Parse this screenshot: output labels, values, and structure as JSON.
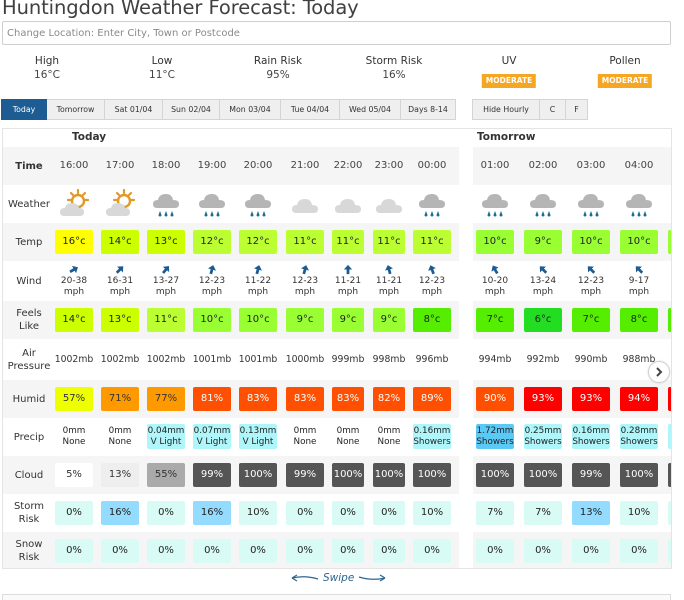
{
  "page": {
    "title": "Huntingdon Weather Forecast: Today",
    "location_placeholder": "Change Location: Enter City, Town or Postcode"
  },
  "summary": {
    "high": {
      "label": "High",
      "value": "16°C"
    },
    "low": {
      "label": "Low",
      "value": "11°C"
    },
    "rain_risk": {
      "label": "Rain Risk",
      "value": "95%"
    },
    "storm_risk": {
      "label": "Storm Risk",
      "value": "16%"
    },
    "uv": {
      "label": "UV",
      "value": "MODERATE"
    },
    "pollen": {
      "label": "Pollen",
      "value": "MODERATE"
    },
    "badge_color": "#f5a623"
  },
  "tabs": [
    {
      "label": "Today",
      "active": true
    },
    {
      "label": "Tomorrow",
      "active": false
    },
    {
      "label": "Sat 01/04",
      "active": false
    },
    {
      "label": "Sun 02/04",
      "active": false
    },
    {
      "label": "Mon 03/04",
      "active": false
    },
    {
      "label": "Tue 04/04",
      "active": false
    },
    {
      "label": "Wed 05/04",
      "active": false
    },
    {
      "label": "Days 8-14",
      "active": false
    }
  ],
  "options": {
    "hide_hourly": "Hide Hourly",
    "celsius": "C",
    "fahrenheit": "F"
  },
  "row_labels": {
    "time": "Time",
    "weather": "Weather",
    "temp": "Temp",
    "wind": "Wind",
    "feels_like": "Feels Like",
    "air_pressure": "Air Pressure",
    "humid": "Humid",
    "precip": "Precip",
    "cloud": "Cloud",
    "storm_risk": "Storm Risk",
    "snow_risk": "Snow Risk"
  },
  "days": [
    {
      "label": "Today"
    },
    {
      "label": "Tomorrow"
    }
  ],
  "hours": [
    {
      "day": 0,
      "time": "16:00",
      "weather": "sun-cloud",
      "temp": "16°c",
      "temp_color": "#ffff00",
      "wind_speed": "20-38",
      "wind_unit": "mph",
      "wind_dir_deg": 60,
      "feels": "14°c",
      "feels_color": "#ccff00",
      "pressure": "1002mb",
      "humid": "57%",
      "humid_color": "#eeff00",
      "humid_text": "#333333",
      "precip_amt": "0mm",
      "precip_type": "None",
      "precip_color": "",
      "cloud": "5%",
      "cloud_color": "#ffffff",
      "cloud_text": "#333333",
      "storm": "0%",
      "storm_color": "#d9fbf6",
      "snow": "0%"
    },
    {
      "day": 0,
      "time": "17:00",
      "weather": "sun-cloud",
      "temp": "14°c",
      "temp_color": "#ccff00",
      "wind_speed": "16-31",
      "wind_unit": "mph",
      "wind_dir_deg": 45,
      "feels": "13°c",
      "feels_color": "#ccff00",
      "pressure": "1002mb",
      "humid": "71%",
      "humid_color": "#ff9900",
      "humid_text": "#333333",
      "precip_amt": "0mm",
      "precip_type": "None",
      "precip_color": "",
      "cloud": "13%",
      "cloud_color": "#eeeeee",
      "cloud_text": "#333333",
      "storm": "16%",
      "storm_color": "#94dcff",
      "snow": "0%"
    },
    {
      "day": 0,
      "time": "18:00",
      "weather": "rain",
      "temp": "13°c",
      "temp_color": "#ccff00",
      "wind_speed": "13-27",
      "wind_unit": "mph",
      "wind_dir_deg": 40,
      "feels": "11°c",
      "feels_color": "#bbff33",
      "pressure": "1002mb",
      "humid": "77%",
      "humid_color": "#ff9900",
      "humid_text": "#333333",
      "precip_amt": "0.04mm",
      "precip_type": "V Light",
      "precip_color": "#aef6fa",
      "cloud": "55%",
      "cloud_color": "#aaaaaa",
      "cloud_text": "#333333",
      "storm": "0%",
      "storm_color": "#d9fbf6",
      "snow": "0%"
    },
    {
      "day": 0,
      "time": "19:00",
      "weather": "rain",
      "temp": "12°c",
      "temp_color": "#bbff33",
      "wind_speed": "12-23",
      "wind_unit": "mph",
      "wind_dir_deg": 15,
      "feels": "10°c",
      "feels_color": "#99ff33",
      "pressure": "1001mb",
      "humid": "81%",
      "humid_color": "#ff4f00",
      "humid_text": "#ffffff",
      "precip_amt": "0.07mm",
      "precip_type": "V Light",
      "precip_color": "#aef6fa",
      "cloud": "99%",
      "cloud_color": "#555555",
      "cloud_text": "#ffffff",
      "storm": "16%",
      "storm_color": "#94dcff",
      "snow": "0%"
    },
    {
      "day": 0,
      "time": "20:00",
      "weather": "rain",
      "temp": "12°c",
      "temp_color": "#bbff33",
      "wind_speed": "11-22",
      "wind_unit": "mph",
      "wind_dir_deg": 15,
      "feels": "10°c",
      "feels_color": "#99ff33",
      "pressure": "1001mb",
      "humid": "83%",
      "humid_color": "#ff4f00",
      "humid_text": "#ffffff",
      "precip_amt": "0.13mm",
      "precip_type": "V Light",
      "precip_color": "#aef6fa",
      "cloud": "100%",
      "cloud_color": "#555555",
      "cloud_text": "#ffffff",
      "storm": "10%",
      "storm_color": "#d9fbf6",
      "snow": "0%"
    },
    {
      "day": 0,
      "time": "21:00",
      "weather": "cloud",
      "temp": "11°c",
      "temp_color": "#bbff33",
      "wind_speed": "12-23",
      "wind_unit": "mph",
      "wind_dir_deg": 15,
      "feels": "9°c",
      "feels_color": "#99ff33",
      "pressure": "1000mb",
      "humid": "83%",
      "humid_color": "#ff4f00",
      "humid_text": "#ffffff",
      "precip_amt": "0mm",
      "precip_type": "None",
      "precip_color": "",
      "cloud": "99%",
      "cloud_color": "#555555",
      "cloud_text": "#ffffff",
      "storm": "0%",
      "storm_color": "#d9fbf6",
      "snow": "0%"
    },
    {
      "day": 0,
      "time": "22:00",
      "weather": "cloud",
      "temp": "11°c",
      "temp_color": "#bbff33",
      "wind_speed": "11-21",
      "wind_unit": "mph",
      "wind_dir_deg": 0,
      "feels": "9°c",
      "feels_color": "#99ff33",
      "pressure": "999mb",
      "humid": "83%",
      "humid_color": "#ff4f00",
      "humid_text": "#ffffff",
      "precip_amt": "0mm",
      "precip_type": "None",
      "precip_color": "",
      "cloud": "100%",
      "cloud_color": "#555555",
      "cloud_text": "#ffffff",
      "storm": "0%",
      "storm_color": "#d9fbf6",
      "snow": "0%"
    },
    {
      "day": 0,
      "time": "23:00",
      "weather": "cloud",
      "temp": "11°c",
      "temp_color": "#bbff33",
      "wind_speed": "11-21",
      "wind_unit": "mph",
      "wind_dir_deg": -15,
      "feels": "9°c",
      "feels_color": "#99ff33",
      "pressure": "998mb",
      "humid": "82%",
      "humid_color": "#ff4f00",
      "humid_text": "#ffffff",
      "precip_amt": "0mm",
      "precip_type": "None",
      "precip_color": "",
      "cloud": "100%",
      "cloud_color": "#555555",
      "cloud_text": "#ffffff",
      "storm": "0%",
      "storm_color": "#d9fbf6",
      "snow": "0%"
    },
    {
      "day": 0,
      "time": "00:00",
      "weather": "rain",
      "temp": "11°c",
      "temp_color": "#bbff33",
      "wind_speed": "12-23",
      "wind_unit": "mph",
      "wind_dir_deg": -20,
      "feels": "8°c",
      "feels_color": "#55ee00",
      "pressure": "996mb",
      "humid": "89%",
      "humid_color": "#ff4f00",
      "humid_text": "#ffffff",
      "precip_amt": "0.16mm",
      "precip_type": "Showers",
      "precip_color": "#aef6fa",
      "cloud": "100%",
      "cloud_color": "#555555",
      "cloud_text": "#ffffff",
      "storm": "10%",
      "storm_color": "#d9fbf6",
      "snow": "0%"
    },
    {
      "day": 1,
      "time": "01:00",
      "weather": "rain",
      "temp": "10°c",
      "temp_color": "#99ff33",
      "wind_speed": "10-20",
      "wind_unit": "mph",
      "wind_dir_deg": -30,
      "feels": "7°c",
      "feels_color": "#55ee00",
      "pressure": "994mb",
      "humid": "90%",
      "humid_color": "#ff4f00",
      "humid_text": "#ffffff",
      "precip_amt": "1.72mm",
      "precip_type": "Showers",
      "precip_color": "#5bc9f5",
      "cloud": "100%",
      "cloud_color": "#555555",
      "cloud_text": "#ffffff",
      "storm": "7%",
      "storm_color": "#d9fbf6",
      "snow": "0%"
    },
    {
      "day": 1,
      "time": "02:00",
      "weather": "rain",
      "temp": "9°c",
      "temp_color": "#99ff33",
      "wind_speed": "13-24",
      "wind_unit": "mph",
      "wind_dir_deg": -45,
      "feels": "6°c",
      "feels_color": "#22dd22",
      "pressure": "992mb",
      "humid": "93%",
      "humid_color": "#ff0000",
      "humid_text": "#ffffff",
      "precip_amt": "0.25mm",
      "precip_type": "Showers",
      "precip_color": "#aef6fa",
      "cloud": "100%",
      "cloud_color": "#555555",
      "cloud_text": "#ffffff",
      "storm": "7%",
      "storm_color": "#d9fbf6",
      "snow": "0%"
    },
    {
      "day": 1,
      "time": "03:00",
      "weather": "rain",
      "temp": "10°c",
      "temp_color": "#99ff33",
      "wind_speed": "12-23",
      "wind_unit": "mph",
      "wind_dir_deg": -45,
      "feels": "7°c",
      "feels_color": "#55ee00",
      "pressure": "990mb",
      "humid": "93%",
      "humid_color": "#ff0000",
      "humid_text": "#ffffff",
      "precip_amt": "0.16mm",
      "precip_type": "Showers",
      "precip_color": "#aef6fa",
      "cloud": "99%",
      "cloud_color": "#555555",
      "cloud_text": "#ffffff",
      "storm": "13%",
      "storm_color": "#94dcff",
      "snow": "0%"
    },
    {
      "day": 1,
      "time": "04:00",
      "weather": "rain",
      "temp": "10°c",
      "temp_color": "#99ff33",
      "wind_speed": "9-17",
      "wind_unit": "mph",
      "wind_dir_deg": -45,
      "feels": "8°c",
      "feels_color": "#55ee00",
      "pressure": "988mb",
      "humid": "94%",
      "humid_color": "#ff0000",
      "humid_text": "#ffffff",
      "precip_amt": "0.28mm",
      "precip_type": "Showers",
      "precip_color": "#aef6fa",
      "cloud": "100%",
      "cloud_color": "#555555",
      "cloud_text": "#ffffff",
      "storm": "10%",
      "storm_color": "#d9fbf6",
      "snow": "0%"
    },
    {
      "day": 1,
      "time": "",
      "weather": "",
      "temp": "",
      "temp_color": "#99ff33",
      "wind_speed": "",
      "wind_unit": "",
      "wind_dir_deg": null,
      "feels": "",
      "feels_color": "#55ee00",
      "pressure": "",
      "humid": "",
      "humid_color": "#ff0000",
      "humid_text": "#ffffff",
      "precip_amt": "0",
      "precip_type": "S",
      "precip_color": "#aef6fa",
      "cloud": "",
      "cloud_color": "#555555",
      "cloud_text": "#ffffff",
      "storm": "",
      "storm_color": "#d9fbf6",
      "snow": ""
    }
  ],
  "swipe": {
    "label": "Swipe"
  },
  "colors": {
    "active_tab": "#1d5c93",
    "wind_arrow": "#1d5c93",
    "rain_drop": "#1d6d8f",
    "sun": "#e09a28",
    "cloud_light": "#d8d8d8",
    "cloud_rain": "#b5b5b5"
  }
}
